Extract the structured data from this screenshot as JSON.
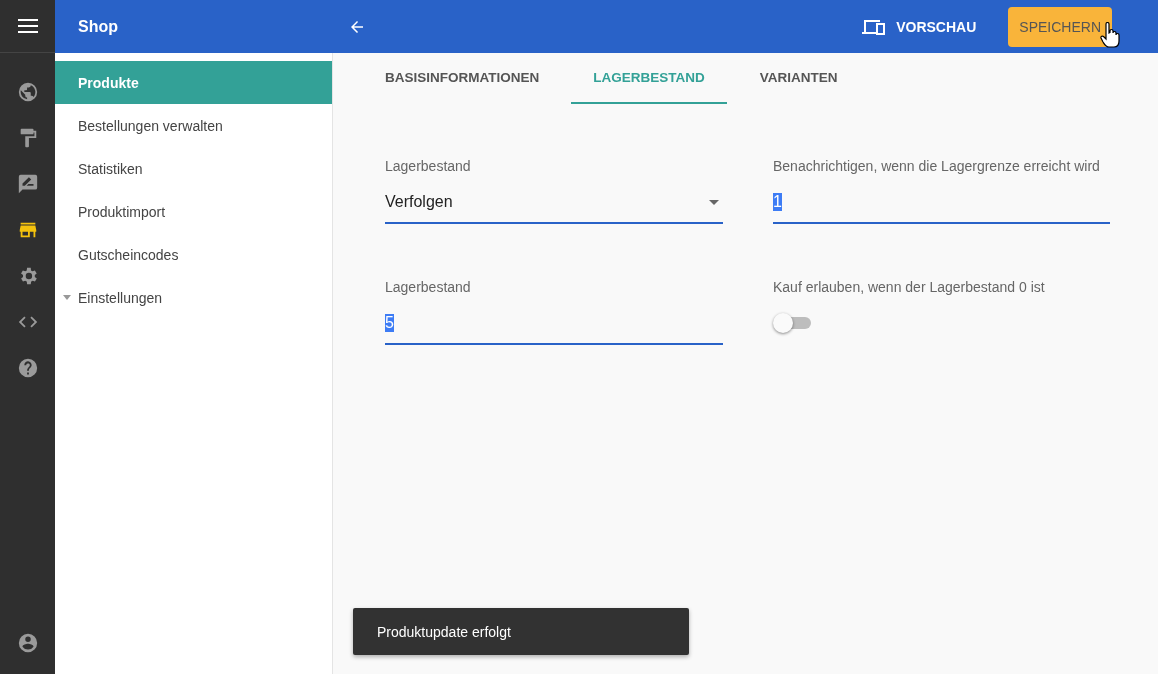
{
  "app_title": "Shop",
  "rail": [
    {
      "kind": "globe",
      "selected": false
    },
    {
      "kind": "roller",
      "selected": false
    },
    {
      "kind": "feedback",
      "selected": false
    },
    {
      "kind": "store",
      "selected": true
    },
    {
      "kind": "gear",
      "selected": false
    },
    {
      "kind": "code",
      "selected": false
    },
    {
      "kind": "help",
      "selected": false
    }
  ],
  "sidebar": {
    "items": [
      {
        "label": "Produkte",
        "selected": true
      },
      {
        "label": "Bestellungen verwalten",
        "selected": false
      },
      {
        "label": "Statistiken",
        "selected": false
      },
      {
        "label": "Produktimport",
        "selected": false
      },
      {
        "label": "Gutscheincodes",
        "selected": false
      },
      {
        "label": "Einstellungen",
        "selected": false,
        "expanded": false
      }
    ]
  },
  "toolbar": {
    "preview": "VORSCHAU",
    "save": "SPEICHERN"
  },
  "tabs": [
    {
      "label": "BASISINFORMATIONEN",
      "selected": false
    },
    {
      "label": "LAGERBESTAND",
      "selected": true
    },
    {
      "label": "VARIANTEN",
      "selected": false
    }
  ],
  "fields": [
    {
      "kind": "select",
      "label": "Lagerbestand",
      "value": "Verfolgen"
    },
    {
      "kind": "text",
      "label": "Benachrichtigen, wenn die Lagergrenze erreicht wird",
      "value": "1",
      "highlighted": true
    },
    {
      "kind": "text",
      "label": "Lagerbestand",
      "value": "5",
      "highlighted": true
    },
    {
      "kind": "toggle",
      "label": "Kauf erlauben, wenn der Lagerbestand 0 ist",
      "on": false
    }
  ],
  "toast": "Produktupdate erfolgt"
}
